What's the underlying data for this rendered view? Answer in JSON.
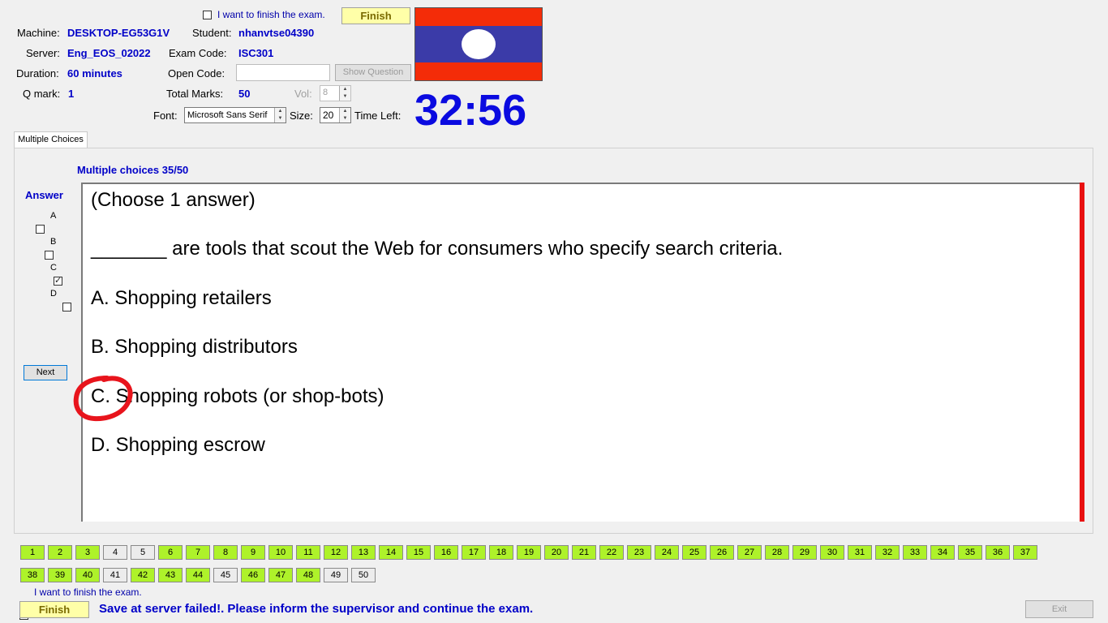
{
  "header": {
    "finish_checkbox_label": "I want to finish the exam.",
    "finish_button": "Finish",
    "machine_label": "Machine:",
    "machine_value": "DESKTOP-EG53G1V",
    "student_label": "Student:",
    "student_value": "nhanvtse04390",
    "server_label": "Server:",
    "server_value": "Eng_EOS_02022",
    "exam_code_label": "Exam Code:",
    "exam_code_value": "ISC301",
    "duration_label": "Duration:",
    "duration_value": "60 minutes",
    "open_code_label": "Open Code:",
    "open_code_value": "",
    "show_question_button": "Show Question",
    "qmark_label": "Q mark:",
    "qmark_value": "1",
    "total_marks_label": "Total Marks:",
    "total_marks_value": "50",
    "vol_label": "Vol:",
    "vol_value": "8",
    "font_label": "Font:",
    "font_value": "Microsoft Sans Serif",
    "size_label": "Size:",
    "size_value": "20",
    "time_left_label": "Time Left:",
    "time_left_value": "32:56",
    "flag_colors": {
      "red": "#f42c08",
      "blue": "#3b3ba8",
      "white": "#ffffff"
    }
  },
  "tab": {
    "label": "Multiple Choices"
  },
  "question": {
    "counter": "Multiple choices 35/50",
    "answer_heading": "Answer",
    "options": [
      {
        "letter": "A",
        "checked": false
      },
      {
        "letter": "B",
        "checked": false
      },
      {
        "letter": "C",
        "checked": true
      },
      {
        "letter": "D",
        "checked": false
      }
    ],
    "next_button": "Next",
    "lines": [
      "(Choose 1 answer)",
      "_______ are tools that scout the Web for consumers who specify search criteria.",
      "A.  Shopping retailers",
      "B.  Shopping distributors",
      "C.  Shopping robots (or shop-bots)",
      "D.  Shopping escrow"
    ]
  },
  "navigation": {
    "row1": [
      {
        "n": "1",
        "a": true
      },
      {
        "n": "2",
        "a": true
      },
      {
        "n": "3",
        "a": true
      },
      {
        "n": "4",
        "a": false
      },
      {
        "n": "5",
        "a": false
      },
      {
        "n": "6",
        "a": true
      },
      {
        "n": "7",
        "a": true
      },
      {
        "n": "8",
        "a": true
      },
      {
        "n": "9",
        "a": true
      },
      {
        "n": "10",
        "a": true
      },
      {
        "n": "11",
        "a": true
      },
      {
        "n": "12",
        "a": true
      },
      {
        "n": "13",
        "a": true
      },
      {
        "n": "14",
        "a": true
      },
      {
        "n": "15",
        "a": true
      },
      {
        "n": "16",
        "a": true
      },
      {
        "n": "17",
        "a": true
      },
      {
        "n": "18",
        "a": true
      },
      {
        "n": "19",
        "a": true
      },
      {
        "n": "20",
        "a": true
      },
      {
        "n": "21",
        "a": true
      },
      {
        "n": "22",
        "a": true
      },
      {
        "n": "23",
        "a": true
      },
      {
        "n": "24",
        "a": true
      },
      {
        "n": "25",
        "a": true
      },
      {
        "n": "26",
        "a": true
      },
      {
        "n": "27",
        "a": true
      },
      {
        "n": "28",
        "a": true
      },
      {
        "n": "29",
        "a": true
      },
      {
        "n": "30",
        "a": true
      },
      {
        "n": "31",
        "a": true
      },
      {
        "n": "32",
        "a": true
      },
      {
        "n": "33",
        "a": true
      },
      {
        "n": "34",
        "a": true
      },
      {
        "n": "35",
        "a": true
      },
      {
        "n": "36",
        "a": true
      },
      {
        "n": "37",
        "a": true
      }
    ],
    "row2": [
      {
        "n": "38",
        "a": true
      },
      {
        "n": "39",
        "a": true
      },
      {
        "n": "40",
        "a": true
      },
      {
        "n": "41",
        "a": false
      },
      {
        "n": "42",
        "a": true
      },
      {
        "n": "43",
        "a": true
      },
      {
        "n": "44",
        "a": true
      },
      {
        "n": "45",
        "a": false
      },
      {
        "n": "46",
        "a": true
      },
      {
        "n": "47",
        "a": true
      },
      {
        "n": "48",
        "a": true
      },
      {
        "n": "49",
        "a": false
      },
      {
        "n": "50",
        "a": false
      }
    ]
  },
  "footer": {
    "finish_checkbox_label": "I want to finish the exam.",
    "finish_button": "Finish",
    "status_message": "Save at server failed!. Please inform the supervisor and continue the exam.",
    "exit_button": "Exit"
  }
}
